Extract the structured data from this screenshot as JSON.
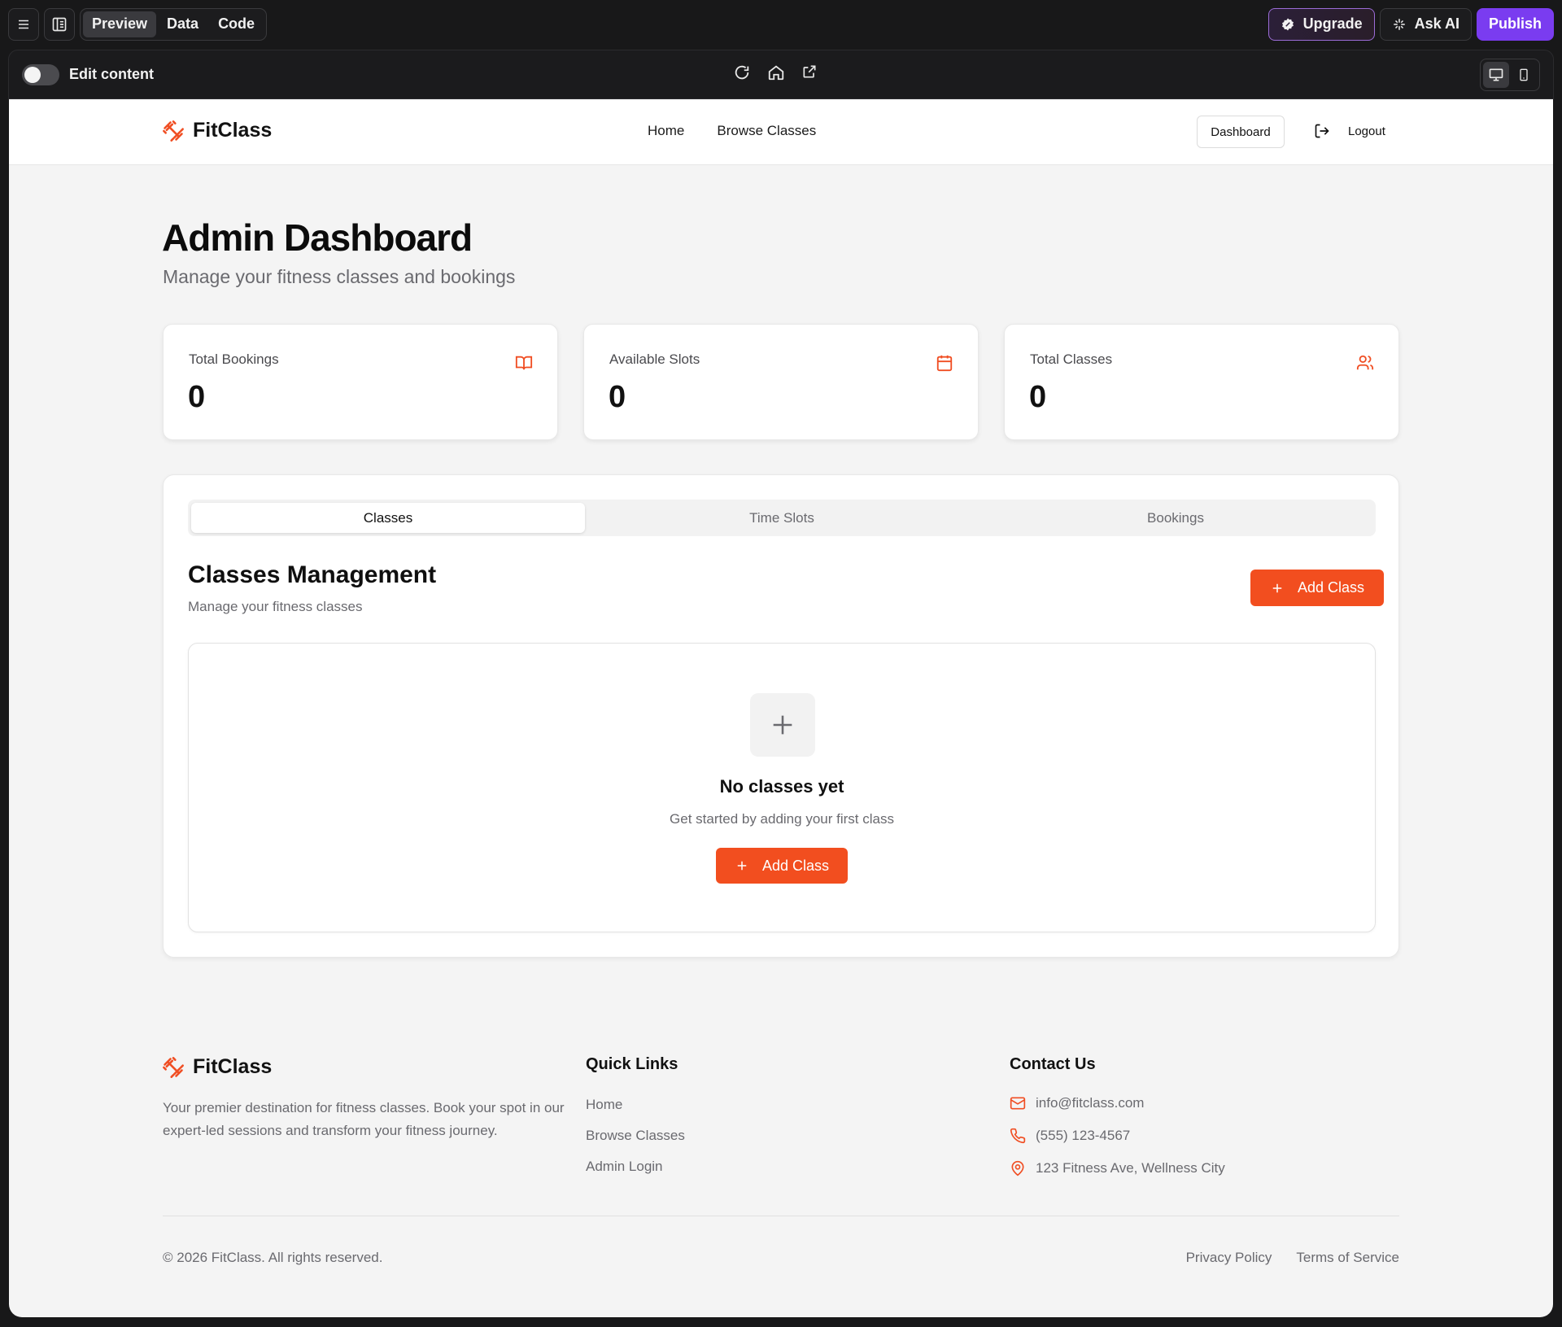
{
  "builder": {
    "tabs": [
      "Preview",
      "Data",
      "Code"
    ],
    "active_tab": "Preview",
    "upgrade_label": "Upgrade",
    "ask_ai_label": "Ask AI",
    "publish_label": "Publish",
    "edit_content_label": "Edit content",
    "accent_color": "#7a3cf0"
  },
  "site": {
    "brand": "FitClass",
    "accent_color": "#f24e1f",
    "nav": {
      "links": [
        "Home",
        "Browse Classes"
      ],
      "dashboard_label": "Dashboard",
      "logout_label": "Logout"
    },
    "page": {
      "title": "Admin Dashboard",
      "subtitle": "Manage your fitness classes and bookings"
    },
    "stats": [
      {
        "label": "Total Bookings",
        "value": "0",
        "icon": "book-open-icon"
      },
      {
        "label": "Available Slots",
        "value": "0",
        "icon": "calendar-icon"
      },
      {
        "label": "Total Classes",
        "value": "0",
        "icon": "users-icon"
      }
    ],
    "panel": {
      "tabs": [
        "Classes",
        "Time Slots",
        "Bookings"
      ],
      "active_tab": "Classes",
      "title": "Classes Management",
      "subtitle": "Manage your fitness classes",
      "add_button": "Add Class",
      "empty": {
        "title": "No classes yet",
        "subtitle": "Get started by adding your first class",
        "button": "Add Class"
      }
    },
    "footer": {
      "brand": "FitClass",
      "description": "Your premier destination for fitness classes. Book your spot in our expert-led sessions and transform your fitness journey.",
      "quick_links_title": "Quick Links",
      "quick_links": [
        "Home",
        "Browse Classes",
        "Admin Login"
      ],
      "contact_title": "Contact Us",
      "email": "info@fitclass.com",
      "phone": "(555) 123-4567",
      "address": "123 Fitness Ave, Wellness City",
      "copyright": "© 2026 FitClass. All rights reserved.",
      "legal_links": [
        "Privacy Policy",
        "Terms of Service"
      ]
    }
  }
}
